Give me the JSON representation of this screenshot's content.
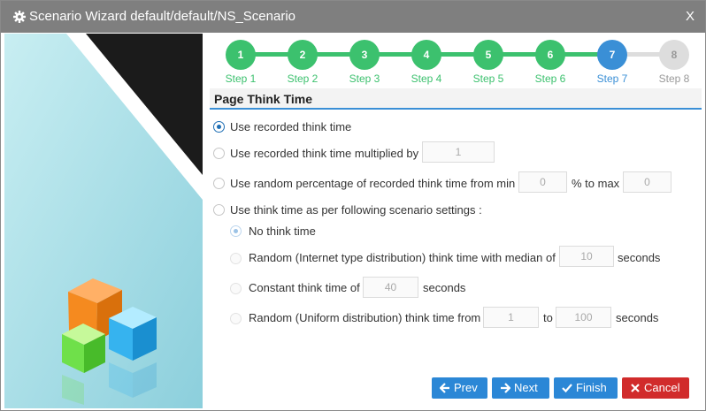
{
  "window": {
    "title": "Scenario Wizard default/default/NS_Scenario",
    "close_label": "X"
  },
  "wizard": {
    "current_step": 7,
    "steps": [
      {
        "number": "1",
        "label": "Step 1",
        "state": "done"
      },
      {
        "number": "2",
        "label": "Step 2",
        "state": "done"
      },
      {
        "number": "3",
        "label": "Step 3",
        "state": "done"
      },
      {
        "number": "4",
        "label": "Step 4",
        "state": "done"
      },
      {
        "number": "5",
        "label": "Step 5",
        "state": "done"
      },
      {
        "number": "6",
        "label": "Step 6",
        "state": "done"
      },
      {
        "number": "7",
        "label": "Step 7",
        "state": "current"
      },
      {
        "number": "8",
        "label": "Step 8",
        "state": "todo"
      }
    ]
  },
  "section": {
    "title": "Page Think Time"
  },
  "options": {
    "recorded": {
      "label": "Use recorded think time",
      "checked": true
    },
    "multiplied": {
      "label": "Use recorded think time multiplied by",
      "value": "1"
    },
    "random_pct": {
      "label_before": "Use random percentage of recorded think time from min",
      "min_value": "0",
      "label_mid": "% to max",
      "max_value": "0"
    },
    "scenario": {
      "label": "Use think time as per following scenario settings :"
    }
  },
  "suboptions": {
    "none": {
      "label": "No think time",
      "checked": true
    },
    "internet": {
      "label_before": "Random (Internet type distribution) think time with median of",
      "value": "10",
      "label_after": "seconds"
    },
    "constant": {
      "label_before": "Constant think time of",
      "value": "40",
      "label_after": "seconds"
    },
    "uniform": {
      "label_before": "Random (Uniform distribution) think time from",
      "from_value": "1",
      "label_mid": "to",
      "to_value": "100",
      "label_after": "seconds"
    }
  },
  "buttons": {
    "prev": "Prev",
    "next": "Next",
    "finish": "Finish",
    "cancel": "Cancel"
  },
  "colors": {
    "titlebar": "#7f7f7f",
    "step_done": "#3cc16e",
    "step_current": "#3a8fd6",
    "step_todo": "#dddddd",
    "primary_button": "#2b87d6",
    "cancel_button": "#d12b2b"
  },
  "icons": [
    "gear-icon",
    "arrow-left-icon",
    "arrow-right-icon",
    "check-icon",
    "close-x-icon",
    "cubes-illustration"
  ]
}
